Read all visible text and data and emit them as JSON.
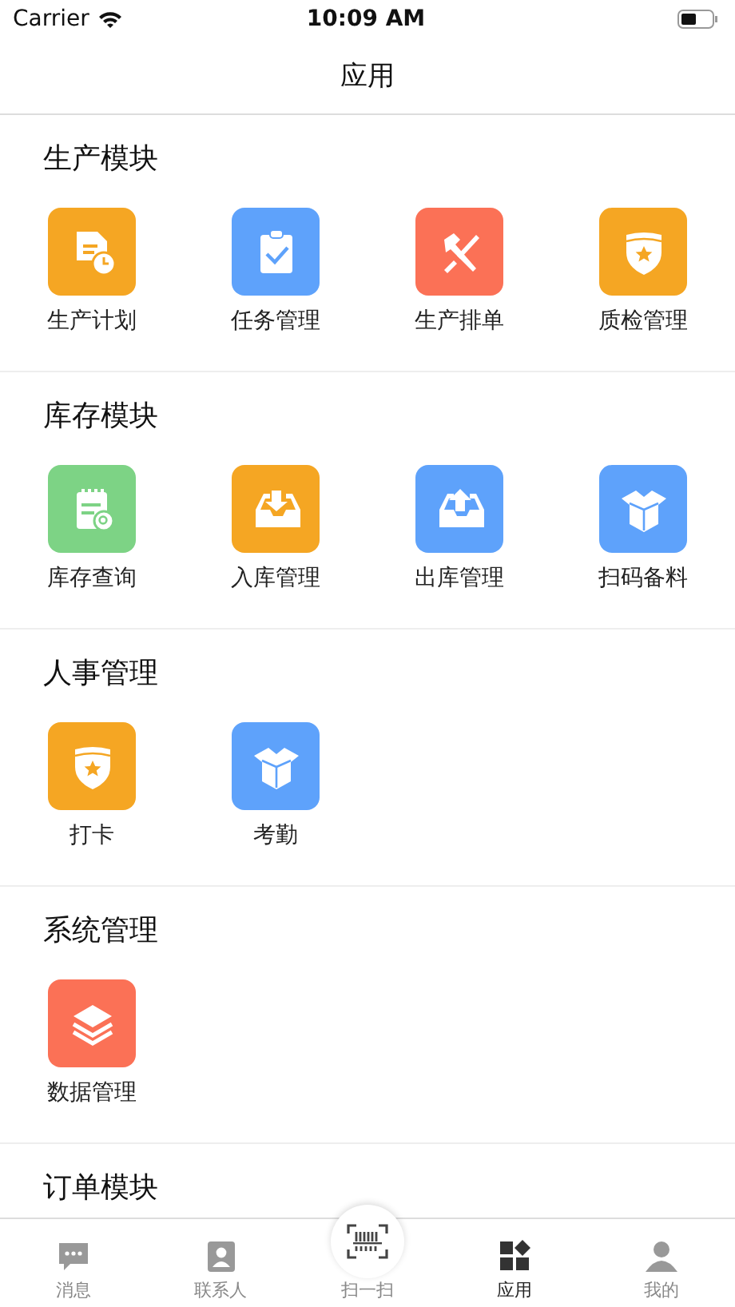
{
  "status_bar": {
    "carrier": "Carrier",
    "time": "10:09 AM"
  },
  "nav": {
    "title": "应用"
  },
  "sections": [
    {
      "title": "生产模块",
      "items": [
        {
          "label": "生产计划",
          "kind": "doc-clock",
          "color": "#f5a623"
        },
        {
          "label": "任务管理",
          "kind": "clipboard",
          "color": "#5ea2fb"
        },
        {
          "label": "生产排单",
          "kind": "tools",
          "color": "#fb7156"
        },
        {
          "label": "质检管理",
          "kind": "shield",
          "color": "#f5a623"
        }
      ]
    },
    {
      "title": "库存模块",
      "items": [
        {
          "label": "库存查询",
          "kind": "notepad",
          "color": "#7dd385"
        },
        {
          "label": "入库管理",
          "kind": "tray-in",
          "color": "#f5a623"
        },
        {
          "label": "出库管理",
          "kind": "tray-out",
          "color": "#5ea2fb"
        },
        {
          "label": "扫码备料",
          "kind": "box",
          "color": "#5ea2fb"
        }
      ]
    },
    {
      "title": "人事管理",
      "items": [
        {
          "label": "打卡",
          "kind": "shield",
          "color": "#f5a623"
        },
        {
          "label": "考勤",
          "kind": "box",
          "color": "#5ea2fb"
        }
      ]
    },
    {
      "title": "系统管理",
      "items": [
        {
          "label": "数据管理",
          "kind": "layers",
          "color": "#fb7156"
        }
      ]
    },
    {
      "title": "订单模块"
    }
  ],
  "tabs": [
    {
      "label": "消息",
      "kind": "chat",
      "selected": false
    },
    {
      "label": "联系人",
      "kind": "contact",
      "selected": false
    },
    {
      "label": "扫一扫",
      "kind": "scan",
      "selected": false
    },
    {
      "label": "应用",
      "kind": "apps",
      "selected": true
    },
    {
      "label": "我的",
      "kind": "person",
      "selected": false
    }
  ]
}
